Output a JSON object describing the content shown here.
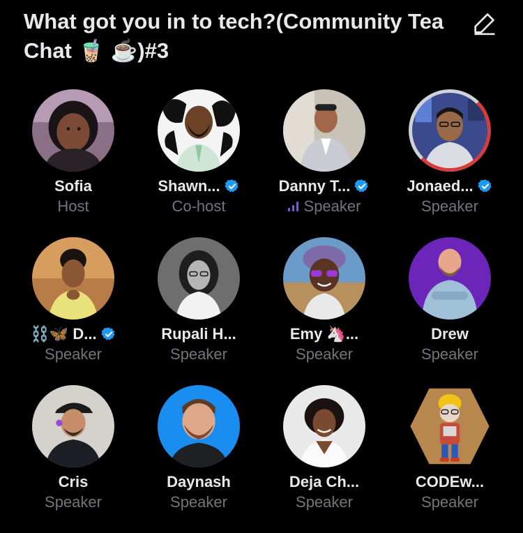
{
  "space": {
    "title": "What got you in to tech?(Community Tea Chat 🧋 ☕️)#3",
    "edit_icon": "pencil-icon"
  },
  "colors": {
    "background": "#000000",
    "text_primary": "#e7e9ea",
    "text_secondary": "#71767b",
    "verified_blue": "#1d9bf0",
    "speaking_purple": "#7856ff",
    "live_red": "#d93b3b"
  },
  "participants": [
    {
      "name": "Sofia",
      "role": "Host",
      "verified": false,
      "speaking": false,
      "avatar_bg": "#8a6f86"
    },
    {
      "name": "Shawn...",
      "role": "Co-host",
      "verified": true,
      "speaking": false,
      "avatar_bg": "#f4f4f4"
    },
    {
      "name": "Danny T...",
      "role": "Speaker",
      "verified": true,
      "speaking": true,
      "avatar_bg": "#c9c2b7"
    },
    {
      "name": "Jonaed...",
      "role": "Speaker",
      "verified": true,
      "speaking": false,
      "avatar_bg": "#3b4a8c"
    },
    {
      "name": "⛓️🦋 D...",
      "role": "Speaker",
      "verified": true,
      "speaking": false,
      "avatar_bg": "#b87c48"
    },
    {
      "name": "Rupali H...",
      "role": "Speaker",
      "verified": false,
      "speaking": false,
      "avatar_bg": "#6e6e6e"
    },
    {
      "name": "Emy 🦄...",
      "role": "Speaker",
      "verified": false,
      "speaking": false,
      "avatar_bg": "#6a9bc9"
    },
    {
      "name": "Drew",
      "role": "Speaker",
      "verified": false,
      "speaking": false,
      "avatar_bg": "#6b25b8"
    },
    {
      "name": "Cris",
      "role": "Speaker",
      "verified": false,
      "speaking": false,
      "avatar_bg": "#d5d2cd"
    },
    {
      "name": "Daynash",
      "role": "Speaker",
      "verified": false,
      "speaking": false,
      "avatar_bg": "#1a8df0"
    },
    {
      "name": "Deja Ch...",
      "role": "Speaker",
      "verified": false,
      "speaking": false,
      "avatar_bg": "#e9e9e9"
    },
    {
      "name": "CODEw...",
      "role": "Speaker",
      "verified": false,
      "speaking": false,
      "avatar_bg": "#b8874e"
    }
  ]
}
